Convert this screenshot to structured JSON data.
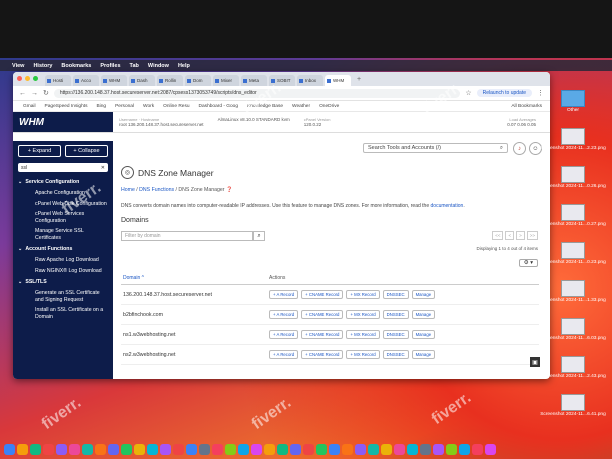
{
  "menubar": {
    "items": [
      "View",
      "History",
      "Bookmarks",
      "Profiles",
      "Tab",
      "Window",
      "Help"
    ]
  },
  "browser": {
    "tabs": [
      "Hosti",
      "Acco",
      "WHM",
      "Dash",
      "Rollin",
      "Dom",
      "Mixer",
      "Meta",
      "SOBIT",
      "Inbox",
      "WHM"
    ],
    "url": "https://136.200.148.37.host.secureserver.net:2087/cpsess1373053749/scripts/dns_editor",
    "relaunch": "Relaunch to update",
    "bookmarks": [
      "Gmail",
      "PageSpeed Insights",
      "Bing",
      "Personal",
      "Work",
      "Online Resu",
      "Dashboard - Goog",
      "Knowledge Base",
      "Weather",
      "OneDrive"
    ],
    "all_bookmarks": "All Bookmarks"
  },
  "whm": {
    "logo": "WHM",
    "server": [
      {
        "label": "Username · Hostname",
        "value": "root      136.200.148.37.host.secureserver.net"
      },
      {
        "label": "OS",
        "value": "AlmaLinux v8.10.0 STANDARD kvm"
      },
      {
        "label": "cPanel Version",
        "value": "120.0.22"
      }
    ],
    "load_label": "Load Averages",
    "load_values": "0.07  0.06  0.05",
    "search_placeholder": "Search Tools and Accounts (/)",
    "notif_icon": "bell-icon",
    "user_icon": "user-icon"
  },
  "sidebar": {
    "expand": "Expand",
    "collapse": "Collapse",
    "search_value": "ssl",
    "sections": [
      {
        "title": "Service Configuration",
        "items": [
          "Apache Configuration",
          "cPanel Web Disk Configuration",
          "cPanel Web Services Configuration",
          "Manage Service SSL Certificates"
        ]
      },
      {
        "title": "Account Functions",
        "items": [
          "Raw Apache Log Download",
          "Raw NGINX® Log Download"
        ]
      },
      {
        "title": "SSL/TLS",
        "items": [
          "Generate an SSL Certificate and Signing Request",
          "Install an SSL Certificate on a Domain"
        ]
      }
    ]
  },
  "page": {
    "title": "DNS Zone Manager",
    "breadcrumb_home": "Home",
    "breadcrumb_sep": " / ",
    "breadcrumb_parent": "DNS Functions",
    "breadcrumb_current": "DNS Zone Manager",
    "description": "DNS converts domain names into computer-readable IP addresses. Use this feature to manage DNS zones. For more information, read the ",
    "doc_link": "documentation",
    "domains_heading": "Domains",
    "filter_placeholder": "Filter by domain",
    "pager": [
      "<<",
      "<",
      ">",
      ">>"
    ],
    "showing": "Displaying 1 to 4 out of 4 items",
    "col_domain": "Domain ^",
    "col_actions": "Actions",
    "action_buttons": [
      "+ A Record",
      "+ CNAME Record",
      "+ MX Record",
      "DNSSEC",
      "Manage"
    ],
    "domains": [
      "136.200.148.37.host.secureserver.net",
      "b2bfinchook.com",
      "ns1.w3webhosting.net",
      "ns2.w3webhosting.net"
    ]
  },
  "desktop": {
    "icons": [
      {
        "label": "Other",
        "icon": "folder-icon"
      },
      {
        "label": "Screenshot 2024-11...2.23.png",
        "icon": "screenshot-icon"
      },
      {
        "label": "Screenshot 2024-11...0.26.png",
        "icon": "screenshot-icon"
      },
      {
        "label": "Screenshot 2024-11...0.27.png",
        "icon": "screenshot-icon"
      },
      {
        "label": "Screenshot 2024-11...0.23.png",
        "icon": "screenshot-icon"
      },
      {
        "label": "Screenshot 2024-11...1.33.png",
        "icon": "screenshot-icon"
      },
      {
        "label": "Screenshot 2024-11...6.03.png",
        "icon": "screenshot-icon"
      },
      {
        "label": "Screenshot 2024-11...2.43.png",
        "icon": "screenshot-icon"
      },
      {
        "label": "Screenshot 2024-11...6.41.png",
        "icon": "screenshot-icon"
      }
    ]
  },
  "watermark": "fiverr."
}
